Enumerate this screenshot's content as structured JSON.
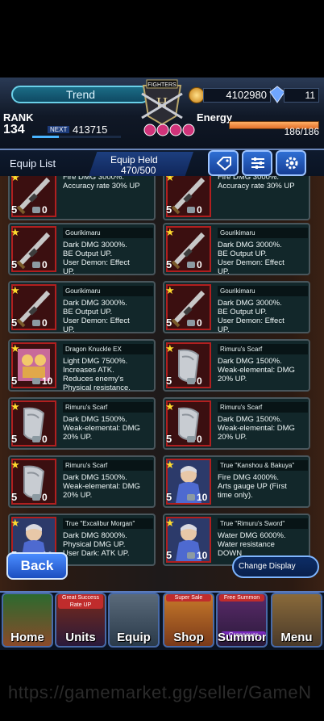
{
  "header": {
    "trend_label": "Trend",
    "logo_text": "FIGHTERS",
    "money": "4102980",
    "gems": "11",
    "rank_label": "RANK",
    "rank_value": "134",
    "next_label": "NEXT",
    "next_value": "413715",
    "energy_label": "Energy",
    "energy_value": "186/186",
    "energy_fraction": 1.0
  },
  "equip_bar": {
    "title": "Equip List",
    "held_label": "Equip Held",
    "held_value": "470/500"
  },
  "cards": [
    {
      "name": "",
      "desc": "Fire DMG 3000%.\nAccuracy rate 30% UP",
      "level": "5",
      "count": "0",
      "icon": "sword-icon"
    },
    {
      "name": "",
      "desc": "Fire DMG 3000%.\nAccuracy rate 30% UP",
      "level": "5",
      "count": "0",
      "icon": "sword-icon"
    },
    {
      "name": "Gourikimaru",
      "desc": "Dark DMG 3000%.\nBE Output UP.\nUser Demon: Effect\nUP.",
      "level": "5",
      "count": "0",
      "icon": "sword-icon"
    },
    {
      "name": "Gourikimaru",
      "desc": "Dark DMG 3000%.\nBE Output UP.\nUser Demon: Effect\nUP.",
      "level": "5",
      "count": "0",
      "icon": "sword-icon"
    },
    {
      "name": "Gourikimaru",
      "desc": "Dark DMG 3000%.\nBE Output UP.\nUser Demon: Effect\nUP.",
      "level": "5",
      "count": "0",
      "icon": "sword-icon"
    },
    {
      "name": "Gourikimaru",
      "desc": "Dark DMG 3000%.\nBE Output UP.\nUser Demon: Effect\nUP.",
      "level": "5",
      "count": "0",
      "icon": "sword-icon"
    },
    {
      "name": "Dragon Knuckle EX",
      "desc": "Light DMG 7500%.\nIncreases ATK.\nReduces enemy's\nPhysical resistance.",
      "level": "5",
      "count": "10",
      "icon": "knuckle-icon"
    },
    {
      "name": "Rimuru's Scarf",
      "desc": "Dark DMG 1500%.\nWeak-elemental: DMG\n20% UP.",
      "level": "5",
      "count": "0",
      "icon": "scarf-icon"
    },
    {
      "name": "Rimuru's Scarf",
      "desc": "Dark DMG 1500%.\nWeak-elemental: DMG\n20% UP.",
      "level": "5",
      "count": "0",
      "icon": "scarf-icon"
    },
    {
      "name": "Rimuru's Scarf",
      "desc": "Dark DMG 1500%.\nWeak-elemental: DMG\n20% UP.",
      "level": "5",
      "count": "0",
      "icon": "scarf-icon"
    },
    {
      "name": "Rimuru's Scarf",
      "desc": "Dark DMG 1500%.\nWeak-elemental: DMG\n20% UP.",
      "level": "5",
      "count": "0",
      "icon": "scarf-icon"
    },
    {
      "name": "True \"Kanshou & Bakuya\"",
      "desc": "Fire DMG 4000%.\nArts gauge UP (First\ntime only).",
      "level": "5",
      "count": "10",
      "icon": "character-icon"
    },
    {
      "name": "True \"Excalibur Morgan\"",
      "desc": "Dark DMG 8000%.\nPhysical DMG UP.\nUser Dark: ATK UP.",
      "level": "5",
      "count": "10",
      "icon": "character-icon"
    },
    {
      "name": "True \"Rimuru's Sword\"",
      "desc": "Water DMG 6000%.\nWater resistance\nDOWN",
      "level": "5",
      "count": "10",
      "icon": "character-icon"
    }
  ],
  "buttons": {
    "back": "Back",
    "change_display": "Change Display"
  },
  "nav": [
    {
      "label": "Home",
      "banner": ""
    },
    {
      "label": "Units",
      "banner": "Great Success Rate UP"
    },
    {
      "label": "Equip",
      "banner": ""
    },
    {
      "label": "Shop",
      "banner": "Super Sale"
    },
    {
      "label": "Summon",
      "banner": "Free Summon",
      "banner2": "Crossover"
    },
    {
      "label": "Menu",
      "banner": ""
    }
  ],
  "watermark": "https://gamemarket.gg/seller/GameN",
  "colors": {
    "accent": "#2f6fd4",
    "card_border": "#b11f1f",
    "energy": "#e2702a"
  }
}
